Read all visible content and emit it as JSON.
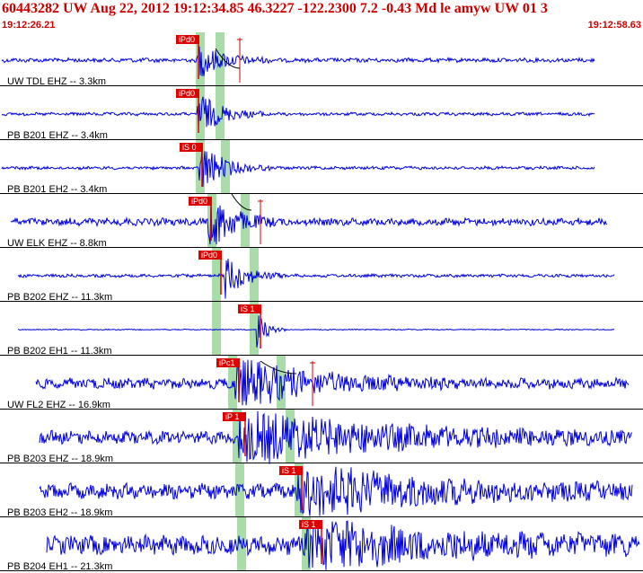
{
  "header": {
    "title": "60443282 UW Aug 22, 2012 19:12:34.85   46.3227 -122.2300  7.2 -0.43 Md le amyw UW 01   3",
    "time_start": "19:12:26.21",
    "time_end": "19:12:58.63"
  },
  "colors": {
    "trace": "#0000dd",
    "pick": "#dd0000",
    "window": "#a8dca8",
    "divider": "#000000",
    "header_text": "#cc0000"
  },
  "channels": [
    {
      "label": "UW TDL EHZ -- 3.3km",
      "pick": "iPd0",
      "s_pick": "",
      "amp": 3,
      "noise": 4,
      "burst": 1.0
    },
    {
      "label": "PB B201 EHZ -- 3.4km",
      "pick": "iPd0",
      "s_pick": "",
      "amp": 2,
      "noise": 3,
      "burst": 1.2
    },
    {
      "label": "PB B201 EH2 -- 3.4km",
      "pick": "iS 0",
      "s_pick": "",
      "amp": 2,
      "noise": 3,
      "burst": 1.4
    },
    {
      "label": "UW ELK EHZ -- 8.8km",
      "pick": "iPd0",
      "s_pick": "",
      "amp": 6,
      "noise": 7,
      "burst": 1.6
    },
    {
      "label": "PB B202 EHZ -- 11.3km",
      "pick": "iPd0",
      "s_pick": "",
      "amp": 3,
      "noise": 3,
      "burst": 1.2
    },
    {
      "label": "PB B202 EH1 -- 11.3km",
      "pick": "iS 1",
      "s_pick": "",
      "amp": 1,
      "noise": 1,
      "burst": 1.0
    },
    {
      "label": "UW FL2 EHZ -- 16.9km",
      "pick": "iPc1",
      "s_pick": "",
      "amp": 8,
      "noise": 10,
      "burst": 1.3
    },
    {
      "label": "PB B203 EHZ -- 18.9km",
      "pick": "iP 1",
      "s_pick": "",
      "amp": 12,
      "noise": 12,
      "burst": 1.4
    },
    {
      "label": "PB B203 EH2 -- 18.9km",
      "pick": "iS 1",
      "s_pick": "",
      "amp": 14,
      "noise": 14,
      "burst": 1.4
    },
    {
      "label": "PB B204 EH1 -- 21.3km",
      "pick": "iS 1",
      "s_pick": "",
      "amp": 18,
      "noise": 18,
      "burst": 1.3
    }
  ]
}
